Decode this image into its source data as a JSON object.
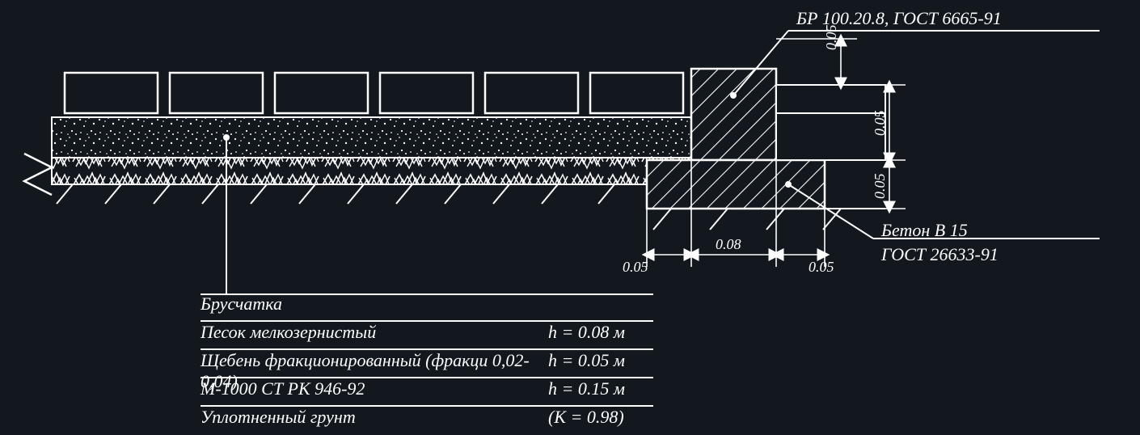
{
  "callouts": {
    "curb": "БР 100.20.8, ГОСТ 6665-91",
    "beton1": "Бетон В 15",
    "beton2": "ГОСТ 26633-91"
  },
  "dims": {
    "top_h": "0.05",
    "mid_h": "0.05",
    "bot_h": "0.05",
    "curb_w": "0.08",
    "left_w": "0.05",
    "right_w": "0.05"
  },
  "legend": {
    "r1_mat": "Брусчатка",
    "r2_mat": "Песок мелкозернистый",
    "r2_val": "h = 0.08 м",
    "r3_mat": "Щебень фракционированный (фракци 0,02-0,04)",
    "r3_val": "h = 0.05 м",
    "r4_mat": "М-1000  СТ РК 946-92",
    "r4_val": "h = 0.15 м",
    "r5_mat": "Уплотненный грунт",
    "r5_val": "(K = 0.98)"
  }
}
